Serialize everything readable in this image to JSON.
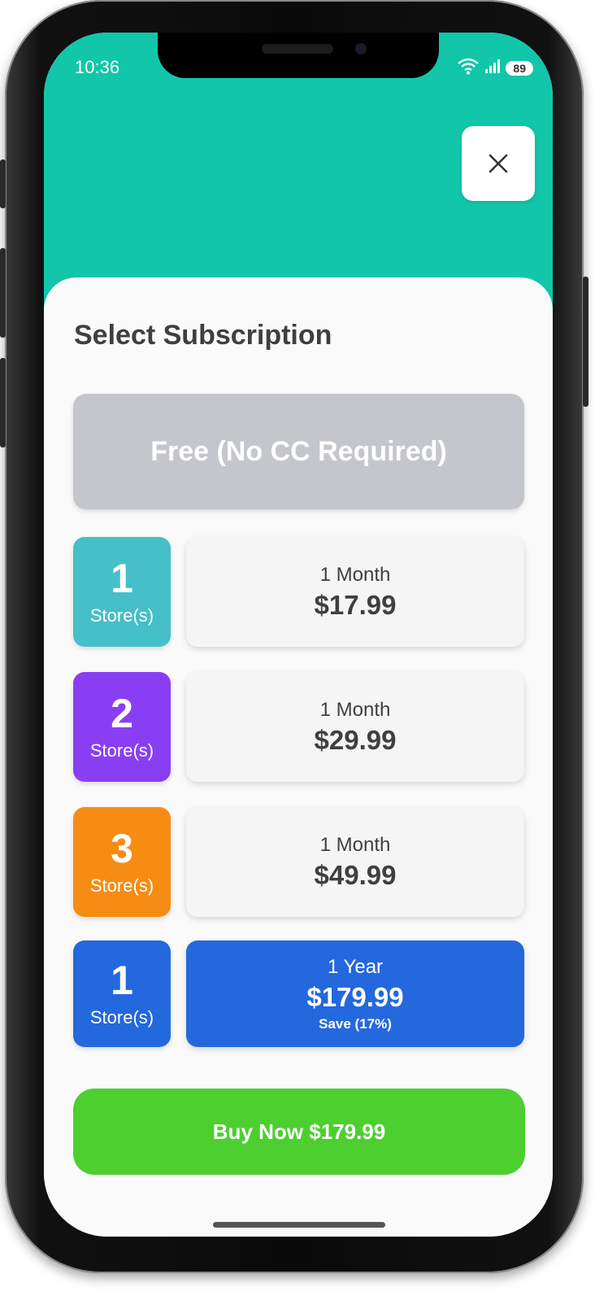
{
  "status_bar": {
    "time": "10:36",
    "battery": "89"
  },
  "close_label": "close",
  "title": "Select Subscription",
  "free_option": "Free (No CC Required)",
  "plans": [
    {
      "stores": "1",
      "stores_label": "Store(s)",
      "period": "1 Month",
      "price": "$17.99",
      "color": "#45bfc8"
    },
    {
      "stores": "2",
      "stores_label": "Store(s)",
      "period": "1 Month",
      "price": "$29.99",
      "color": "#8a3ef3"
    },
    {
      "stores": "3",
      "stores_label": "Store(s)",
      "period": "1 Month",
      "price": "$49.99",
      "color": "#f68c13"
    },
    {
      "stores": "1",
      "stores_label": "Store(s)",
      "period": "1 Year",
      "price": "$179.99",
      "save": "Save (17%)",
      "color": "#2468dd",
      "selected": true
    }
  ],
  "buy_button": "Buy Now $179.99",
  "colors": {
    "header": "#12c6aa",
    "buy": "#4dcf30",
    "free": "#c4c6cb",
    "selected": "#2468dd"
  }
}
